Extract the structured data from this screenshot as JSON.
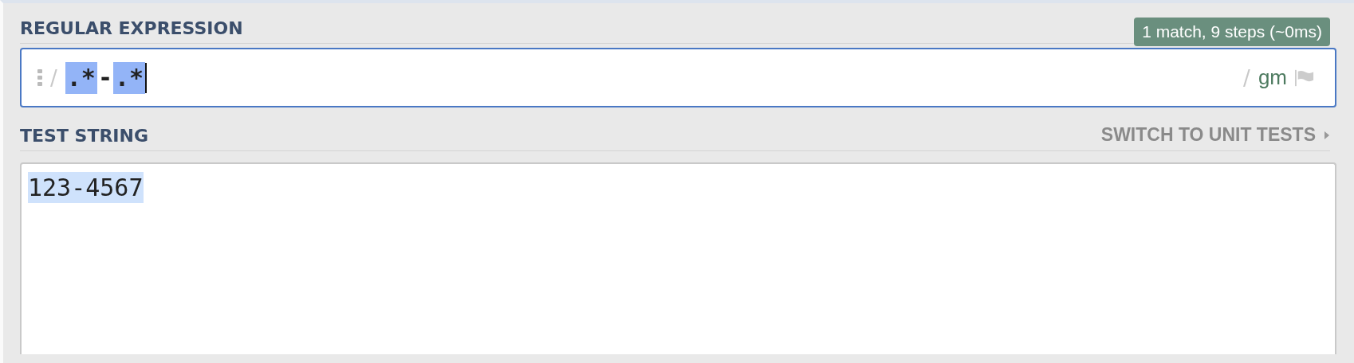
{
  "regex_section": {
    "heading": "REGULAR EXPRESSION",
    "status": "1 match, 9 steps (~0ms)",
    "open_delimiter": "/",
    "tokens": [
      {
        "text": ".*",
        "highlighted": true
      },
      {
        "text": "-",
        "highlighted": false
      },
      {
        "text": ".*",
        "highlighted": true
      }
    ],
    "close_delimiter": "/",
    "flags": "gm"
  },
  "test_section": {
    "heading": "TEST STRING",
    "switch_link": "SWITCH TO UNIT TESTS",
    "segments": [
      {
        "text": "123-4567",
        "matched": true
      }
    ]
  }
}
